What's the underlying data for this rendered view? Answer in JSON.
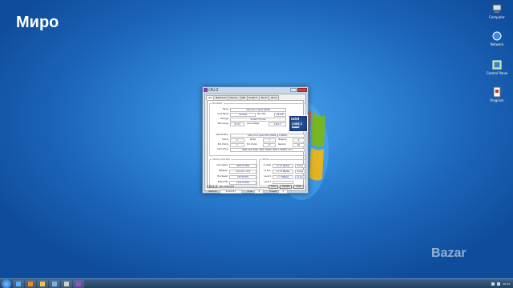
{
  "overlay_title": "Миро",
  "desktop_icons": [
    {
      "label": "Computer",
      "icon": "computer-icon"
    },
    {
      "label": "Network",
      "icon": "network-icon"
    },
    {
      "label": "Control Panel",
      "icon": "control-panel-icon"
    },
    {
      "label": "Program",
      "icon": "program-icon"
    }
  ],
  "cpuz": {
    "title": "CPU-Z",
    "tabs": [
      "CPU",
      "Mainboard",
      "Memory",
      "SPD",
      "Graphics",
      "Bench",
      "About"
    ],
    "processor_group": "Processor",
    "name_label": "Name",
    "name": "Intel Core 2 Quad Q9400",
    "code_label": "Code Name",
    "code": "Yorkfield",
    "tdp_label": "Max TDP",
    "tdp": "95.0 W",
    "package_label": "Package",
    "package": "Socket 775 LGA",
    "tech_label": "Technology",
    "tech": "45 nm",
    "voltage_label": "Core Voltage",
    "voltage": "1.224 V",
    "spec_label": "Specification",
    "spec": "Intel Core 2 Quad CPU Q9400 @ 2.66GHz",
    "family_label": "Family",
    "family": "6",
    "model_label": "Model",
    "model": "7",
    "stepping_label": "Stepping",
    "stepping": "A",
    "extfam_label": "Ext. Family",
    "extfam": "6",
    "extmod_label": "Ext. Model",
    "extmod": "17",
    "rev_label": "Revision",
    "rev": "R0",
    "instr_label": "Instructions",
    "instr": "MMX, SSE, SSE2, SSE3, SSSE3, SSE4.1, EM64T, VT-x",
    "intel_logo": "intel",
    "intel_core": "CORE 2 Quad",
    "intel_inside": "inside",
    "clocks_group": "Clocks (Core #0)",
    "core_speed_label": "Core Speed",
    "core_speed": "2003.33 MHz",
    "mult_label": "Multiplier",
    "mult": "x 6.0 (6.0 - 8.0)",
    "bus_label": "Bus Speed",
    "bus": "333.89 MHz",
    "fsb_label": "Rated FSB",
    "fsb": "1335.54 MHz",
    "cache_group": "Cache",
    "l1d_label": "L1 Data",
    "l1d": "4 x 32 KBytes",
    "l1d_way": "8-way",
    "l1i_label": "L1 Inst.",
    "l1i": "4 x 32 KBytes",
    "l1i_way": "8-way",
    "l2_label": "Level 2",
    "l2": "2 x 3 MBytes",
    "l2_way": "12-way",
    "l3_label": "Level 3",
    "l3": "",
    "selection_label": "Selection",
    "selection": "Socket #1",
    "cores_label": "Cores",
    "cores": "4",
    "threads_label": "Threads",
    "threads": "4",
    "brand": "CPU-Z",
    "version": "Ver. 2.06.0.x64",
    "tools_btn": "Tools",
    "validate_btn": "Validate",
    "close_btn": "Close"
  },
  "taskbar": {
    "items": [
      "explorer-icon",
      "media-icon",
      "folder-icon",
      "app-icon",
      "app-icon",
      "cpu-z-icon"
    ],
    "time": "20:32"
  },
  "watermark": "Bazar"
}
